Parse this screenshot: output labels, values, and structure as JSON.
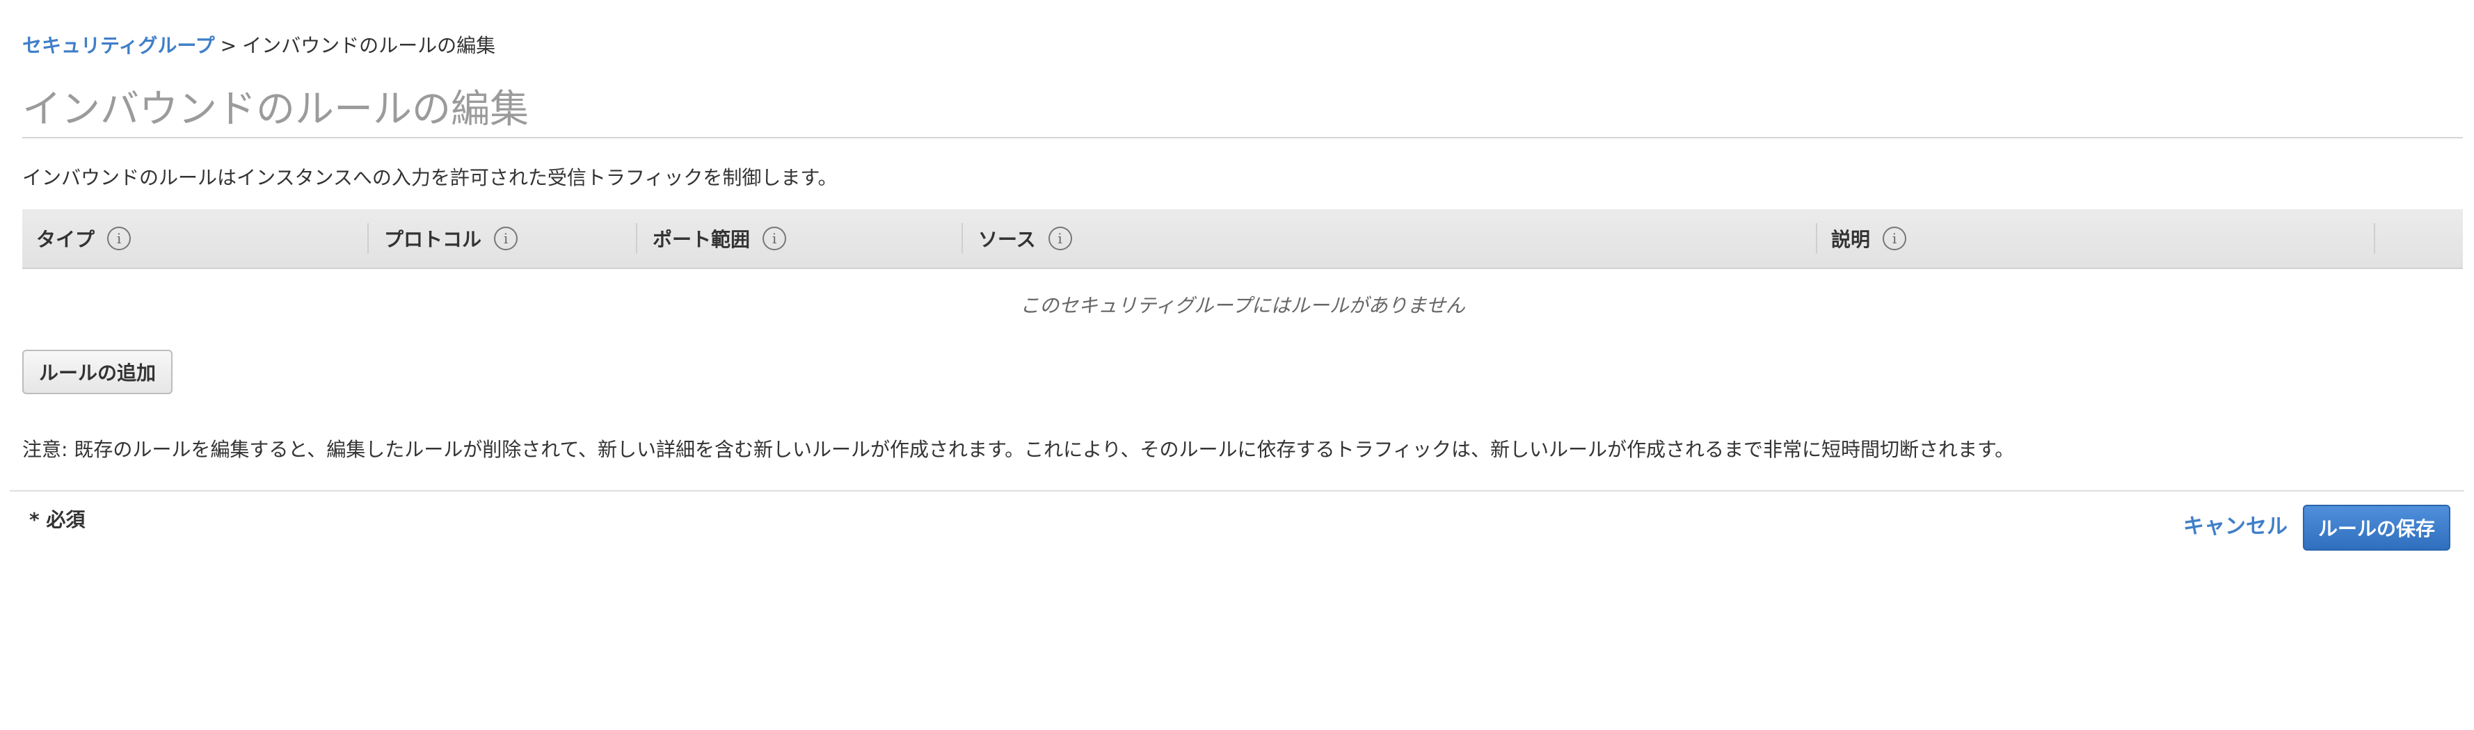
{
  "breadcrumb": {
    "parent_label": "セキュリティグループ",
    "separator": ">",
    "current_label": "インバウンドのルールの編集"
  },
  "page_title": "インバウンドのルールの編集",
  "description": "インバウンドのルールはインスタンスへの入力を許可された受信トラフィックを制御します。",
  "table": {
    "columns": [
      {
        "label": "タイプ",
        "info_icon": "i"
      },
      {
        "label": "プロトコル",
        "info_icon": "i"
      },
      {
        "label": "ポート範囲",
        "info_icon": "i"
      },
      {
        "label": "ソース",
        "info_icon": "i"
      },
      {
        "label": "説明",
        "info_icon": "i"
      }
    ],
    "empty_message": "このセキュリティグループにはルールがありません"
  },
  "add_rule_label": "ルールの追加",
  "notice": "注意: 既存のルールを編集すると、編集したルールが削除されて、新しい詳細を含む新しいルールが作成されます。これにより、そのルールに依存するトラフィックは、新しいルールが作成されるまで非常に短時間切断されます。",
  "footer": {
    "required_note": "* 必須",
    "cancel_label": "キャンセル",
    "save_label": "ルールの保存"
  },
  "colors": {
    "link": "#3f7fc8",
    "primary_button": "#3b7dd0",
    "title_gray": "#9b9b9b"
  }
}
